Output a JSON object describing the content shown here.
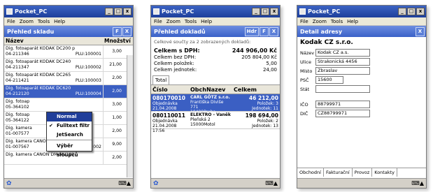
{
  "app_title": "Pocket_PC",
  "menu": [
    "File",
    "Zoom",
    "Tools",
    "Help"
  ],
  "w1": {
    "header": "Přehled skladu",
    "buttons": [
      "F",
      "X"
    ],
    "col_name": "Název",
    "col_qty": "Množství",
    "rows": [
      {
        "name": "Dig. fotoaparát KODAK DC200 p",
        "code": "04-211346",
        "plu": "PLU:100001",
        "qty": "3,00"
      },
      {
        "name": "Dig. fotoaparát KODAK DC240",
        "code": "04-211347",
        "plu": "PLU:100002",
        "qty": "21,00"
      },
      {
        "name": "Dig. fotoaparát KODAK DC265",
        "code": "04-211421",
        "plu": "PLU:100003",
        "qty": "2,00"
      },
      {
        "name": "Dig. fotoaparát KODAK DC620",
        "code": "04-212120",
        "plu": "PLU:100004",
        "qty": "2,00"
      },
      {
        "name": "Dig. fotoap",
        "code": "05-364102",
        "plu": "",
        "qty": "3,00"
      },
      {
        "name": "Dig. fotoap",
        "code": "05-364122",
        "plu": "",
        "qty": "1,00"
      },
      {
        "name": "Dig. kamera",
        "code": "01-007577",
        "plu": "",
        "qty": "2,00"
      },
      {
        "name": "Dig. kamera CANON DM-MV10",
        "code": "01-007567",
        "plu": "PLU:200002",
        "qty": "9,00"
      },
      {
        "name": "Dig. kamera CANON DM-MV100",
        "code": "",
        "plu": "",
        "qty": "2,00"
      }
    ],
    "context_menu": [
      "Normal",
      "Fulltext filtr",
      "JetSearch",
      "Výběr sloupců"
    ]
  },
  "w2": {
    "header": "Přehled dokladů",
    "buttons": [
      "Hdr",
      "F",
      "X"
    ],
    "info": "Celkové součty za 2 zobrazených dokladů:",
    "totals": [
      {
        "label": "Celkem s DPH:",
        "value": "244 906,00 Kč"
      },
      {
        "label": "Celkem bez DPH:",
        "value": "205 804,00 Kč"
      },
      {
        "label": "Celkem položek:",
        "value": "5,00"
      },
      {
        "label": "Celkem jednotek:",
        "value": "24,00"
      }
    ],
    "tab": "Total",
    "cols": [
      "Číslo",
      "ObchNazev",
      "Celkem"
    ],
    "rows": [
      {
        "num": "080170010",
        "type": "Objednávka",
        "date": "21.04.2008 17:58",
        "company": "CARL GÖTZ s.r.o.",
        "street": "Františka Diviše 771",
        "city": "10400Praha",
        "total": "46 212,00",
        "items": "Položek: 3",
        "units": "Jednotek: 11"
      },
      {
        "num": "080110011",
        "type": "Objednávka",
        "date": "21.04.2008 17:56",
        "company": "ELEKTRO - Vaněk",
        "street": "Pleňská 2",
        "city": "15000Motol",
        "total": "198 694,00",
        "items": "Položek: 2",
        "units": "Jednotek: 13"
      }
    ]
  },
  "w3": {
    "header": "Detail adresy",
    "buttons": [
      "X"
    ],
    "company": "Kodak CZ s.r.o.",
    "fields": [
      {
        "label": "Název",
        "value": "Kodak CZ a.s."
      },
      {
        "label": "Ulice",
        "value": "Strakonická 4456"
      },
      {
        "label": "Místo",
        "value": "Zbraslav"
      },
      {
        "label": "PSČ",
        "value": "15600"
      },
      {
        "label": "Stát",
        "value": ""
      }
    ],
    "ids": [
      {
        "label": "IČO",
        "value": "88799971"
      },
      {
        "label": "DIČ",
        "value": "CZ88799971"
      }
    ],
    "tabs": [
      "Obchodní",
      "Fakturační",
      "Provoz",
      "Kontakty"
    ]
  }
}
